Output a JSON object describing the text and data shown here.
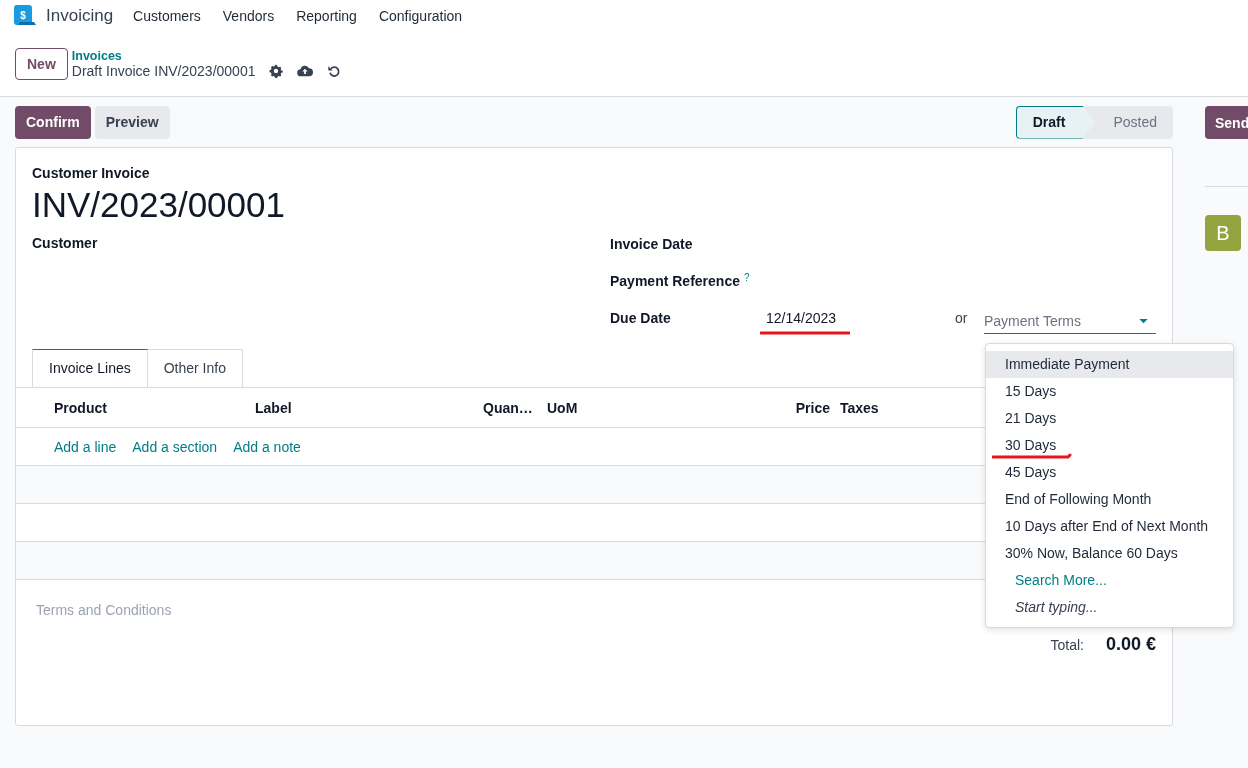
{
  "app": {
    "logo_mark": "$",
    "name": "Invoicing",
    "menu": [
      "Customers",
      "Vendors",
      "Reporting",
      "Configuration"
    ]
  },
  "breadcrumb": {
    "new_button": "New",
    "parent": "Invoices",
    "current": "Draft Invoice INV/2023/00001"
  },
  "actions": [
    {
      "label": "Confirm",
      "kind": "primary"
    },
    {
      "label": "Preview",
      "kind": "secondary"
    }
  ],
  "status": [
    {
      "label": "Draft",
      "selected": true
    },
    {
      "label": "Posted",
      "selected": false
    }
  ],
  "chatter": {
    "send_button": "Send",
    "avatar": "B"
  },
  "form": {
    "type_label": "Customer Invoice",
    "number": "INV/2023/00001",
    "customer_label": "Customer",
    "invoice_date_label": "Invoice Date",
    "payment_reference_label": "Payment Reference",
    "help_mark": "?",
    "due_date_label": "Due Date",
    "due_date": "12/14/2023",
    "due_date_underlined": true,
    "or": "or",
    "payment_terms_placeholder": "Payment Terms"
  },
  "tabs": [
    {
      "label": "Invoice Lines",
      "selected": true
    },
    {
      "label": "Other Info",
      "selected": false
    }
  ],
  "table": {
    "columns": [
      "Product",
      "Label",
      "Quan…",
      "UoM",
      "Price",
      "Taxes"
    ],
    "add_links": [
      "Add a line",
      "Add a section",
      "Add a note"
    ]
  },
  "dropdown": {
    "items": [
      {
        "label": "Immediate Payment",
        "selected": true,
        "underlined": false
      },
      {
        "label": "15 Days",
        "selected": false,
        "underlined": false
      },
      {
        "label": "21 Days",
        "selected": false,
        "underlined": false
      },
      {
        "label": "30 Days",
        "selected": false,
        "underlined": true
      },
      {
        "label": "45 Days",
        "selected": false,
        "underlined": false
      },
      {
        "label": "End of Following Month",
        "selected": false,
        "underlined": false
      },
      {
        "label": "10 Days after End of Next Month",
        "selected": false,
        "underlined": false
      },
      {
        "label": "30% Now, Balance 60 Days",
        "selected": false,
        "underlined": false
      }
    ],
    "search_more": "Search More...",
    "hint": "Start typing..."
  },
  "footer": {
    "terms_placeholder": "Terms and Conditions",
    "total_label": "Total:",
    "total": "0.00 €"
  }
}
